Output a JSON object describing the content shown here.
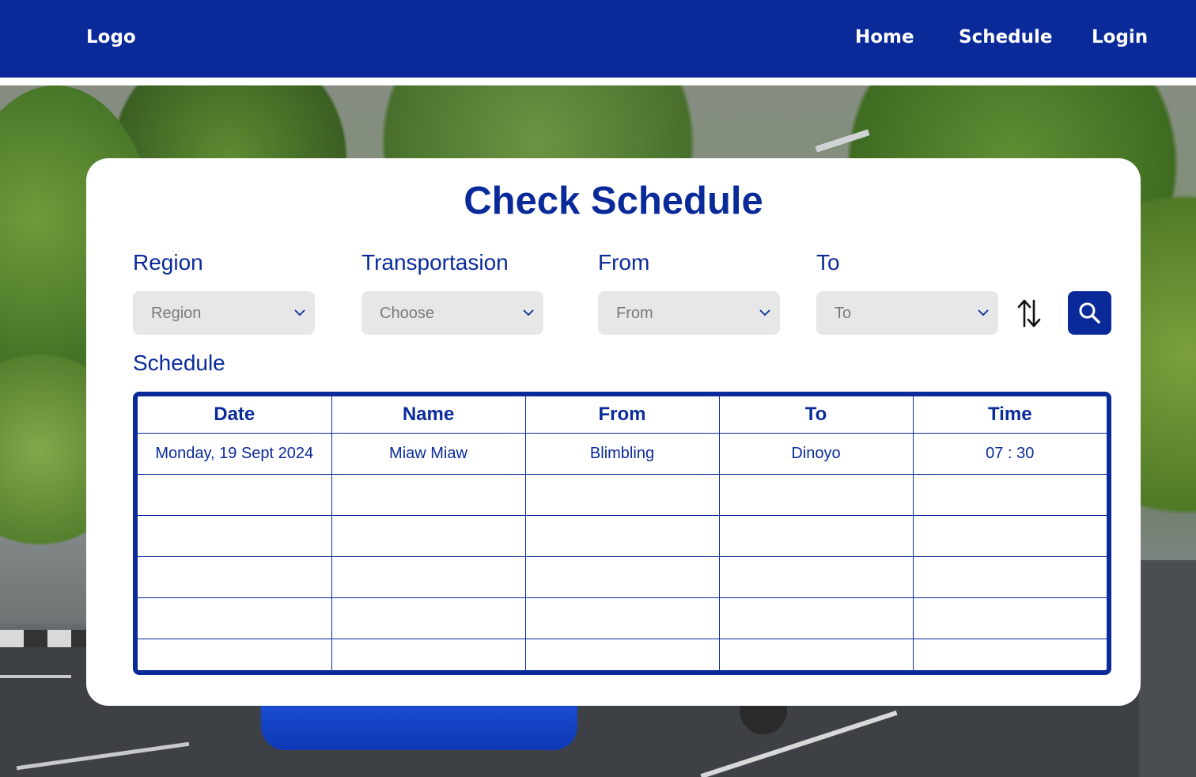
{
  "nav": {
    "logo": "Logo",
    "links": [
      "Home",
      "Schedule",
      "Login"
    ]
  },
  "card": {
    "title": "Check Schedule",
    "filters": {
      "region": {
        "label": "Region",
        "value": "Region"
      },
      "transport": {
        "label": "Transportasion",
        "value": "Choose"
      },
      "from": {
        "label": "From",
        "value": "From"
      },
      "to": {
        "label": "To",
        "value": "To"
      }
    },
    "schedule_label": "Schedule",
    "table": {
      "headers": [
        "Date",
        "Name",
        "From",
        "To",
        "Time"
      ],
      "rows": [
        [
          "Monday, 19 Sept 2024",
          "Miaw Miaw",
          "Blimbling",
          "Dinoyo",
          "07 : 30"
        ],
        [
          "",
          "",
          "",
          "",
          ""
        ],
        [
          "",
          "",
          "",
          "",
          ""
        ],
        [
          "",
          "",
          "",
          "",
          ""
        ],
        [
          "",
          "",
          "",
          "",
          ""
        ],
        [
          "",
          "",
          "",
          "",
          ""
        ]
      ]
    }
  },
  "icons": {
    "swap": "swap-vertical-icon",
    "search": "search-icon",
    "chevron": "chevron-down-icon"
  },
  "colors": {
    "brand": "#0a2a9a",
    "select_bg": "#e7e7e8",
    "placeholder": "#7a7a7a"
  }
}
